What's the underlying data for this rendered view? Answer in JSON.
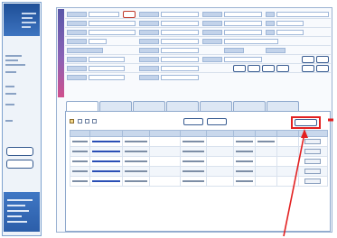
{
  "colors": {
    "sidebar_blue": "#2c5ea9",
    "form_tab_gradient": [
      "#5a57a8",
      "#8a63b6",
      "#d0508d"
    ],
    "highlight_red": "#e32020",
    "link_blue": "#2a4fb5"
  },
  "sidebar": {
    "buttons": [
      {
        "label": "",
        "icon": "sidebar-button"
      },
      {
        "label": "",
        "icon": "sidebar-button"
      }
    ]
  },
  "form": {
    "rows": 9,
    "field_labels": [],
    "field_values": []
  },
  "tabs": [
    {
      "label": "",
      "active": true
    },
    {
      "label": "",
      "active": false
    },
    {
      "label": "",
      "active": false
    },
    {
      "label": "",
      "active": false
    },
    {
      "label": "",
      "active": false
    },
    {
      "label": "",
      "active": false
    },
    {
      "label": "",
      "active": false
    }
  ],
  "list": {
    "toolbar": {
      "add_button_label": "",
      "highlighted_button_label": ""
    },
    "columns": [
      "",
      "",
      "",
      "",
      "",
      "",
      "",
      "",
      "",
      ""
    ],
    "rows": [
      {
        "cells": [
          "",
          "",
          "",
          "",
          "",
          "",
          "",
          "",
          "",
          ""
        ]
      },
      {
        "cells": [
          "",
          "",
          "",
          "",
          "",
          "",
          "",
          "",
          "",
          ""
        ]
      },
      {
        "cells": [
          "",
          "",
          "",
          "",
          "",
          "",
          "",
          "",
          "",
          ""
        ]
      },
      {
        "cells": [
          "",
          "",
          "",
          "",
          "",
          "",
          "",
          "",
          "",
          ""
        ]
      },
      {
        "cells": [
          "",
          "",
          "",
          "",
          "",
          "",
          "",
          "",
          "",
          ""
        ]
      }
    ]
  },
  "annotation": {
    "arrow_color": "#e32020",
    "target": "highlighted-list-toolbar-button"
  }
}
